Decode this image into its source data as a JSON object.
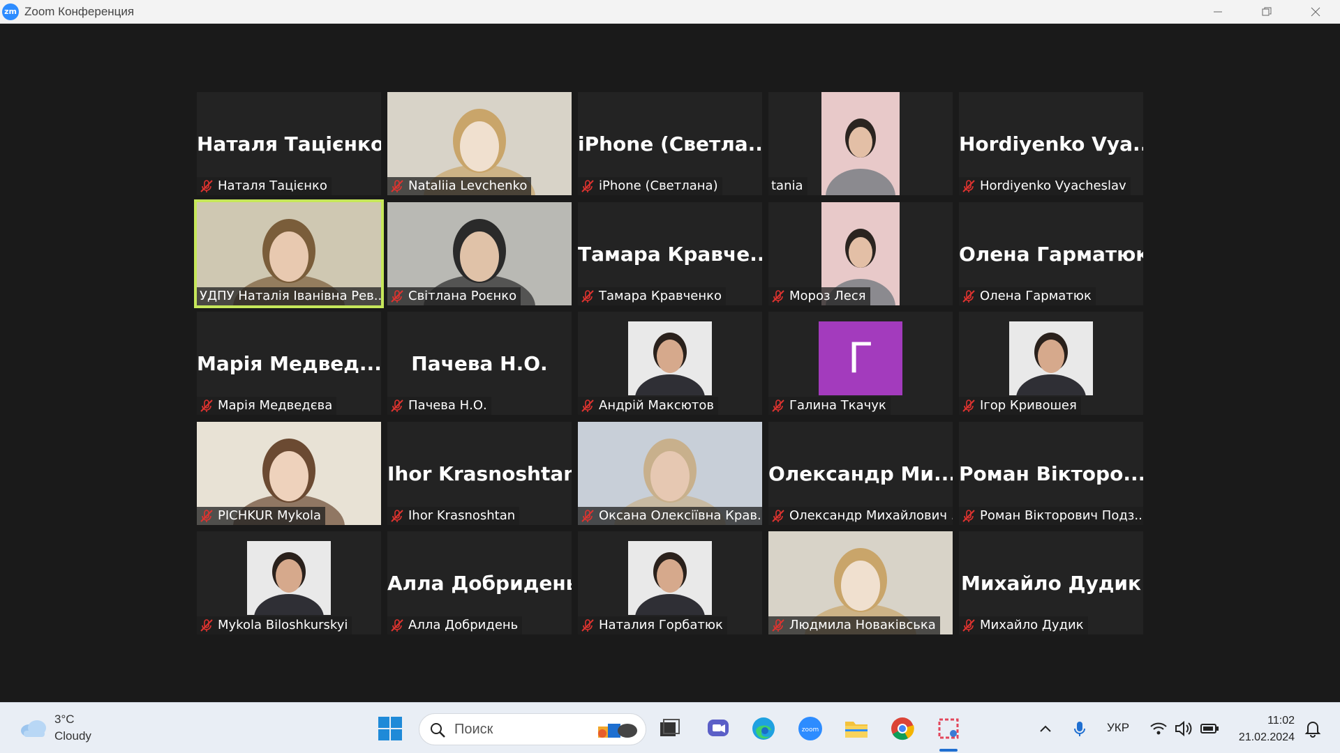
{
  "window": {
    "app_icon": "zm",
    "title": "Zoom Конференция"
  },
  "colors": {
    "active_speaker": "#c6e75a",
    "mic_muted": "#e0332f",
    "letter_avatar": "#a33bbd"
  },
  "tiles": [
    {
      "big": "Наталя Тацієнко",
      "label": "Наталя Тацієнко",
      "muted": true,
      "video": "none"
    },
    {
      "big": "",
      "label": "Nataliia Levchenko",
      "muted": true,
      "video": "camera"
    },
    {
      "big": "iPhone  (Светла...",
      "label": "iPhone (Светлана)",
      "muted": true,
      "video": "none"
    },
    {
      "big": "",
      "label": "tania",
      "muted": false,
      "video": "portrait"
    },
    {
      "big": "Hordiyenko  Vya...",
      "label": "Hordiyenko Vyacheslav",
      "muted": true,
      "video": "none"
    },
    {
      "big": "",
      "label": "УДПУ Наталія Іванівна Рев...",
      "muted": false,
      "video": "camera",
      "active": true
    },
    {
      "big": "",
      "label": "Світлана Роєнко",
      "muted": true,
      "video": "camera"
    },
    {
      "big": "Тамара  Кравче...",
      "label": "Тамара Кравченко",
      "muted": true,
      "video": "none"
    },
    {
      "big": "",
      "label": "Мороз Леся",
      "muted": true,
      "video": "portrait"
    },
    {
      "big": "Олена Гарматюк",
      "label": "Олена Гарматюк",
      "muted": true,
      "video": "none"
    },
    {
      "big": "Марія  Медвед...",
      "label": "Марія Медведєва",
      "muted": true,
      "video": "none"
    },
    {
      "big": "Пачева Н.О.",
      "label": "Пачева Н.О.",
      "muted": true,
      "video": "none"
    },
    {
      "big": "",
      "label": "Андрій Максютов",
      "muted": true,
      "video": "avatar"
    },
    {
      "big": "",
      "label": "Галина Ткачук",
      "muted": true,
      "video": "letter",
      "letter": "Г"
    },
    {
      "big": "",
      "label": "Ігор Кривошея",
      "muted": true,
      "video": "avatar"
    },
    {
      "big": "",
      "label": "PICHKUR Mykola",
      "muted": true,
      "video": "camera"
    },
    {
      "big": "Ihor Krasnoshtan",
      "label": "Ihor Krasnoshtan",
      "muted": true,
      "video": "none"
    },
    {
      "big": "",
      "label": "Оксана Олексіївна Крав...",
      "muted": true,
      "video": "camera"
    },
    {
      "big": "Олександр  Ми...",
      "label": "Олександр Михайлович ...",
      "muted": true,
      "video": "none"
    },
    {
      "big": "Роман  Вікторо...",
      "label": "Роман Вікторович Подз...",
      "muted": true,
      "video": "none"
    },
    {
      "big": "",
      "label": "Mykola Biloshkurskyi",
      "muted": true,
      "video": "avatar"
    },
    {
      "big": "Алла Добридень",
      "label": "Алла Добридень",
      "muted": true,
      "video": "none"
    },
    {
      "big": "",
      "label": "Наталия Горбатюк",
      "muted": true,
      "video": "avatar"
    },
    {
      "big": "",
      "label": "Людмила Новаківська",
      "muted": true,
      "video": "camera"
    },
    {
      "big": "Михайло Дудик",
      "label": "Михайло Дудик",
      "muted": true,
      "video": "none"
    }
  ],
  "taskbar": {
    "weather_temp": "3°C",
    "weather_desc": "Cloudy",
    "search_placeholder": "Поиск",
    "lang": "УКР",
    "time": "11:02",
    "date": "21.02.2024"
  }
}
